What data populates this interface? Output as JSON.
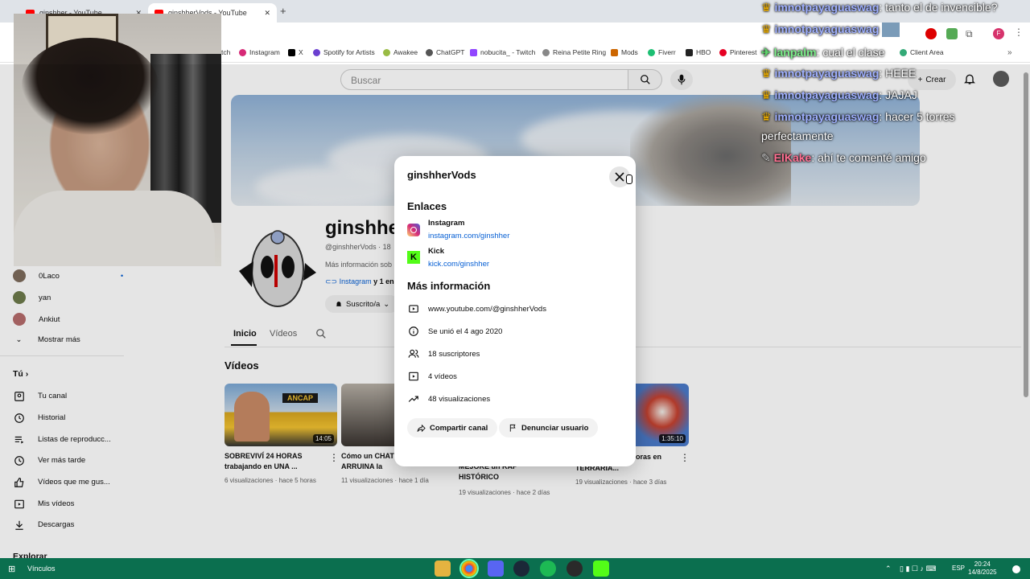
{
  "browser": {
    "tabs": [
      {
        "label": "ginshher - YouTube"
      },
      {
        "label": "ginshherVods - YouTube"
      }
    ],
    "bookmarks": [
      "tch",
      "Instagram",
      "X",
      "Spotify for Artists",
      "Awakee",
      "ChatGPT",
      "nobucita_ - Twitch",
      "Reina Petite Ring",
      "Mods",
      "Fiverr",
      "HBO",
      "Pinterest",
      "Client Area"
    ]
  },
  "youtube": {
    "search_placeholder": "Buscar",
    "create_label": "Crear",
    "channel_name": "ginshhe",
    "handle": "@ginshherVods · 18",
    "more_info": "Más información sob",
    "links_row_a": "Instagram",
    "links_row_b": "y 1 enla",
    "subscribed_label": "Suscrito/a",
    "tabs": [
      "Inicio",
      "Vídeos"
    ],
    "videos_heading": "Vídeos",
    "videos": [
      {
        "title": "SOBREVIVÍ 24 HORAS trabajando en UNA ...",
        "meta": "6 visualizaciones · hace 5 horas",
        "duration": "14:05",
        "thumb_text": "ANCAP"
      },
      {
        "title": "Cómo un CHAT ARRUINA la CARRERA",
        "meta": "11 visualizaciones · hace 1 día",
        "duration": ""
      },
      {
        "title": "MEJORÉ un RAP HISTÓRICO",
        "meta": "19 visualizaciones · hace 2 días",
        "duration": ""
      },
      {
        "title": "TERRARIA...",
        "title_b": "oras en",
        "meta": "19 visualizaciones · hace 3 días",
        "duration": "1:35:10"
      }
    ]
  },
  "sidebar": {
    "subs": [
      "0Laco",
      "yan",
      "Ankiut"
    ],
    "show_more": "Mostrar más",
    "you_label": "Tú",
    "items": [
      "Tu canal",
      "Historial",
      "Listas de reproducc...",
      "Ver más tarde",
      "Vídeos que me gus...",
      "Mis vídeos",
      "Descargas"
    ],
    "explore": "Explorar"
  },
  "modal": {
    "title": "ginshherVods",
    "links_heading": "Enlaces",
    "links": [
      {
        "name": "Instagram",
        "url": "instagram.com/ginshher"
      },
      {
        "name": "Kick",
        "url": "kick.com/ginshher"
      }
    ],
    "more_heading": "Más información",
    "info": [
      {
        "icon": "globe-icon",
        "text": "www.youtube.com/@ginshherVods"
      },
      {
        "icon": "info-icon",
        "text": "Se unió el 4 ago 2020"
      },
      {
        "icon": "people-icon",
        "text": "18 suscriptores"
      },
      {
        "icon": "video-icon",
        "text": "4 vídeos"
      },
      {
        "icon": "trending-icon",
        "text": "48 visualizaciones"
      }
    ],
    "share_label": "Compartir canal",
    "report_label": "Denunciar usuario"
  },
  "chat": [
    {
      "user": "imnotpayaguaswag",
      "msg": "tanto el de invencible?"
    },
    {
      "user": "imnotpayaguaswag",
      "msg": ""
    },
    {
      "user": "lanpalm",
      "msg": "cual el clase"
    },
    {
      "user": "imnotpayaguaswag",
      "msg": "HEEE"
    },
    {
      "user": "imnotpayaguaswag",
      "msg": "JAJAJ"
    },
    {
      "user": "imnotpayaguaswag",
      "msg": "hacer 5 torres"
    },
    {
      "user": "",
      "msg": "perfectamente"
    },
    {
      "user": "ElKake",
      "msg": "ahí te comenté amigo"
    }
  ],
  "taskbar": {
    "left_label": "Vínculos",
    "lang": "ESP",
    "time": "20:24",
    "date": "14/8/2025"
  }
}
